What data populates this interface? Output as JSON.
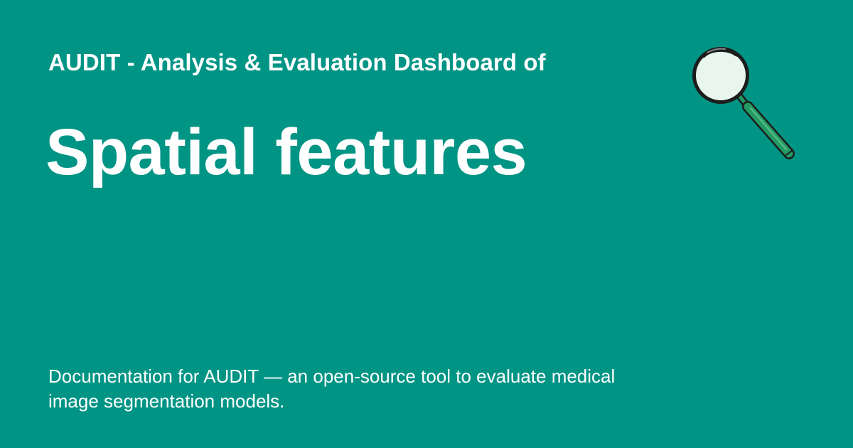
{
  "header": {
    "site_title": "AUDIT - Analysis & Evaluation Dashboard of"
  },
  "main": {
    "page_title": "Spatial features",
    "description": "Documentation for AUDIT — an open-source tool to evaluate medical image segmentation models."
  },
  "logo": {
    "icon": "magnifying-glass-icon"
  },
  "colors": {
    "background": "#009485",
    "text": "#ffffff",
    "lens_fill": "#e9f6ee",
    "handle": "#239a63",
    "outline": "#1c1c1c"
  }
}
